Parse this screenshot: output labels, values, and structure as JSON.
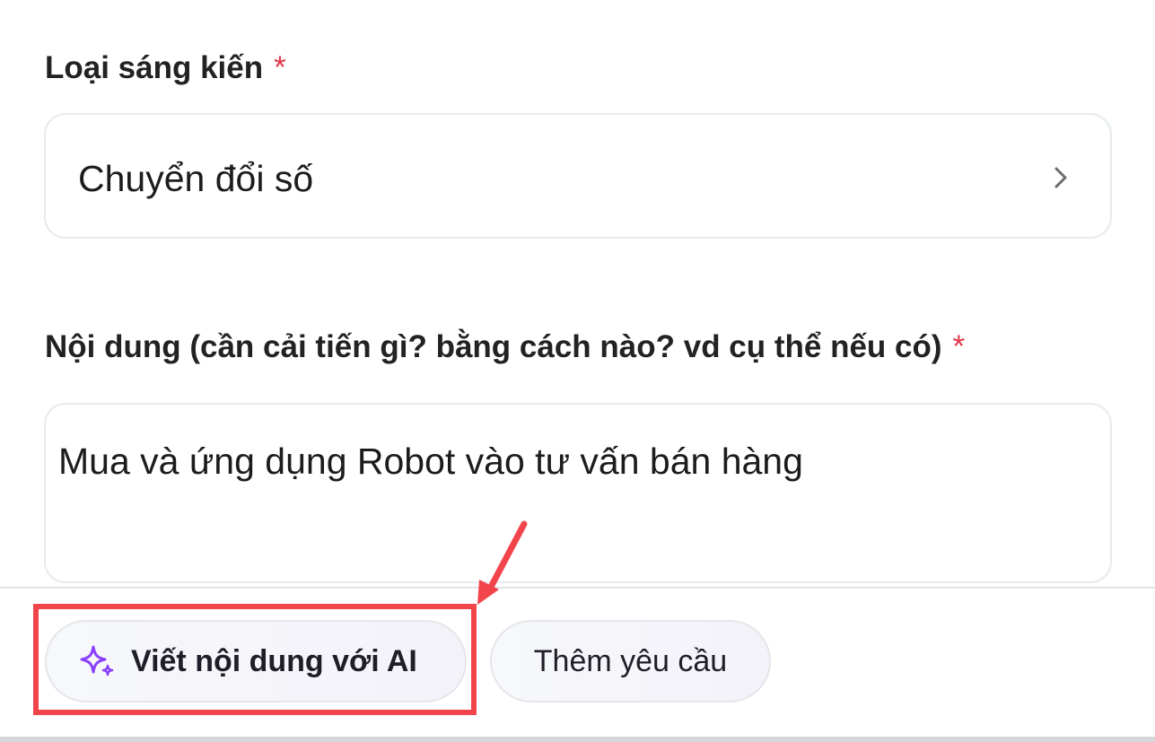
{
  "form": {
    "type_field": {
      "label": "Loại sáng kiến",
      "required_mark": "*",
      "value": "Chuyển đổi số"
    },
    "content_field": {
      "label": "Nội dung (cần cải tiến gì? bằng cách nào? vd cụ thể nếu có)",
      "required_mark": "*",
      "value": "Mua và ứng dụng Robot vào tư vấn bán hàng"
    }
  },
  "actions": {
    "ai_write_label": "Viết nội dung với AI",
    "add_request_label": "Thêm yêu cầu"
  },
  "icons": {
    "select_chevron": "chevron-right-icon",
    "ai_button_icon": "sparkle-icon"
  },
  "colors": {
    "required_mark": "#e5364a",
    "sparkle_icon": "#8a3ffc",
    "annotation": "#f2444b"
  }
}
